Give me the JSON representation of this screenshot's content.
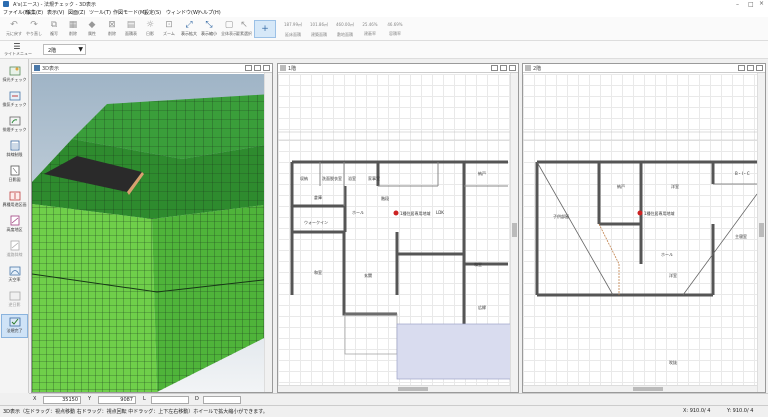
{
  "app": {
    "title": "A's(エース) - 法規チェック - 3D表示"
  },
  "menu": [
    "ファイル(F)",
    "編集(E)",
    "表示(V)",
    "図面(Z)",
    "ツール(T)",
    "作図モード(M)",
    "設定(S)",
    "ウィンドウ(W)",
    "ヘルプ(H)"
  ],
  "toolbar": {
    "buttons": [
      {
        "icon": "undo-icon",
        "label": "元に戻す"
      },
      {
        "icon": "redo-icon",
        "label": "やり直し"
      },
      {
        "icon": "copy-icon",
        "label": "複写"
      },
      {
        "icon": "delete-icon",
        "label": "削除"
      },
      {
        "icon": "attribute-icon",
        "label": "属性"
      },
      {
        "icon": "delete2-icon",
        "label": "削除"
      },
      {
        "icon": "area-list-icon",
        "label": "面積表"
      },
      {
        "icon": "sun-icon",
        "label": "日影"
      },
      {
        "icon": "zoom-window-icon",
        "label": "ズーム"
      },
      {
        "icon": "zoom-in-icon",
        "label": "表示拡大"
      },
      {
        "icon": "zoom-out-icon",
        "label": "表示縮小"
      },
      {
        "icon": "fit-icon",
        "label": "全体表示"
      },
      {
        "icon": "select-icon",
        "label": "要素選択"
      }
    ],
    "stats": [
      {
        "value": "187.99㎡",
        "label": "延床面積"
      },
      {
        "value": "101.86㎡",
        "label": "建築面積"
      },
      {
        "value": "460.00㎡",
        "label": "敷地面積"
      },
      {
        "value": "25.46%",
        "label": "建蔽率"
      },
      {
        "value": "46.69%",
        "label": "容積率"
      }
    ]
  },
  "toolbar2": {
    "menu_label": "ライトメニュー",
    "floor": "2階"
  },
  "sidebar": [
    {
      "label": "採光チェック",
      "enabled": true
    },
    {
      "label": "換気チェック",
      "enabled": true
    },
    {
      "label": "排煙チェック",
      "enabled": true
    },
    {
      "label": "斜線制限",
      "enabled": true
    },
    {
      "label": "日影図",
      "enabled": true
    },
    {
      "label": "異種用途区画",
      "enabled": true
    },
    {
      "label": "高度地区",
      "enabled": true
    },
    {
      "label": "道路斜線",
      "enabled": false
    },
    {
      "label": "天空率",
      "enabled": true
    },
    {
      "label": "逆日影",
      "enabled": false
    },
    {
      "label": "法規完了",
      "enabled": true,
      "selected": true
    }
  ],
  "panes": [
    {
      "title": "3D表示"
    },
    {
      "title": "1階"
    },
    {
      "title": "2階"
    }
  ],
  "plan1": {
    "rooms": [
      "収納",
      "洗面脱衣室",
      "浴室",
      "家事室",
      "納戸",
      "階段",
      "ホール",
      "LDK",
      "ウォークイン",
      "倉庫",
      "和室",
      "玄関",
      "和室",
      "広縁"
    ],
    "note": "1種住居専用地域"
  },
  "plan2": {
    "rooms": [
      "納戸",
      "洋室",
      "子供部屋",
      "洋室",
      "ホール",
      "主寝室",
      "吹抜",
      "B・I・C"
    ],
    "note": "1種住居専用地域"
  },
  "coords": {
    "x_label": "X",
    "x": "35150",
    "y_label": "Y",
    "y": "9087",
    "l_label": "L",
    "d_label": "D"
  },
  "status": {
    "left": "3D表示（左ドラッグ：視点移動 右ドラッグ：視点回転 中ドラッグ：上下左右移動）ホイールで拡大縮小ができます。",
    "x": "X: 910.0/ 4",
    "y": "Y: 910.0/ 4"
  },
  "colors": {
    "roof_green": "#2e8b2e",
    "wall_green": "#6fcf4a",
    "sky_top": "#9fb4c6",
    "selection": "#cfe3f7"
  }
}
